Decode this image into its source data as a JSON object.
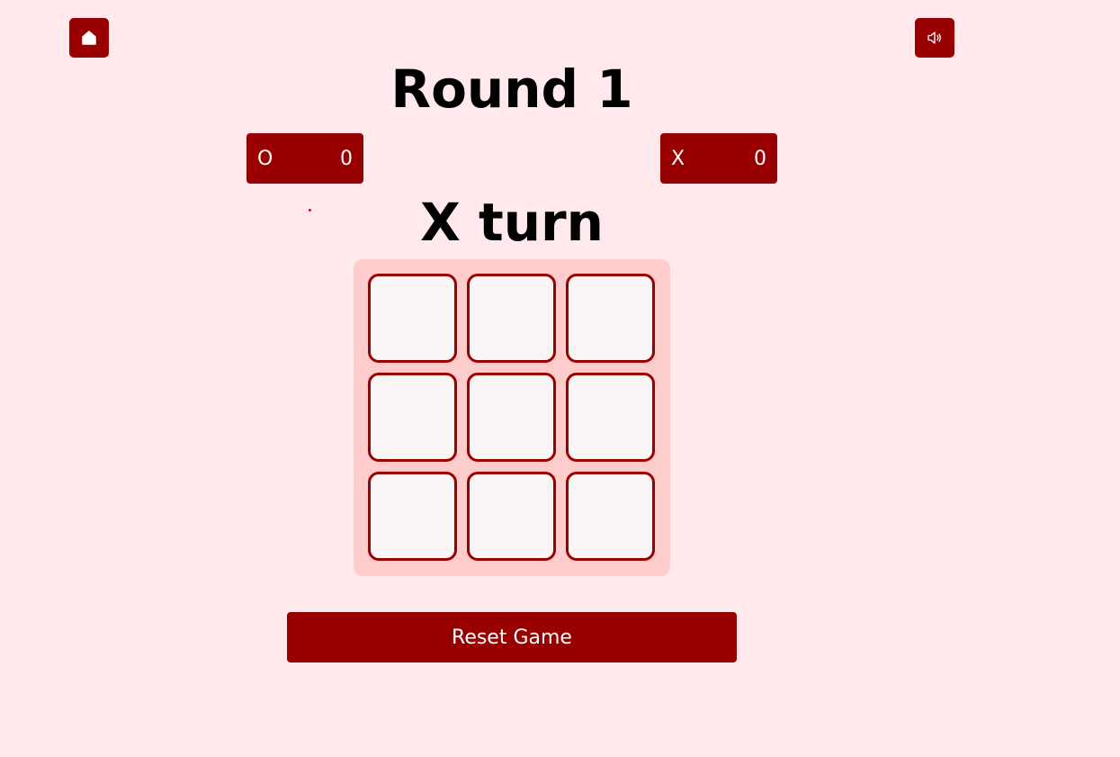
{
  "header": {
    "home_icon": "home-icon",
    "sound_icon": "speaker-icon"
  },
  "title": "Round 1",
  "scores": {
    "o": {
      "symbol": "O",
      "value": "0"
    },
    "x": {
      "symbol": "X",
      "value": "0"
    }
  },
  "turn": "X turn",
  "board": {
    "cells": [
      "",
      "",
      "",
      "",
      "",
      "",
      "",
      "",
      ""
    ]
  },
  "reset_label": "Reset Game",
  "colors": {
    "background": "#ffe9ec",
    "accent": "#990000",
    "board_bg": "#ffcccc",
    "cell_bg": "#faf5f5"
  }
}
